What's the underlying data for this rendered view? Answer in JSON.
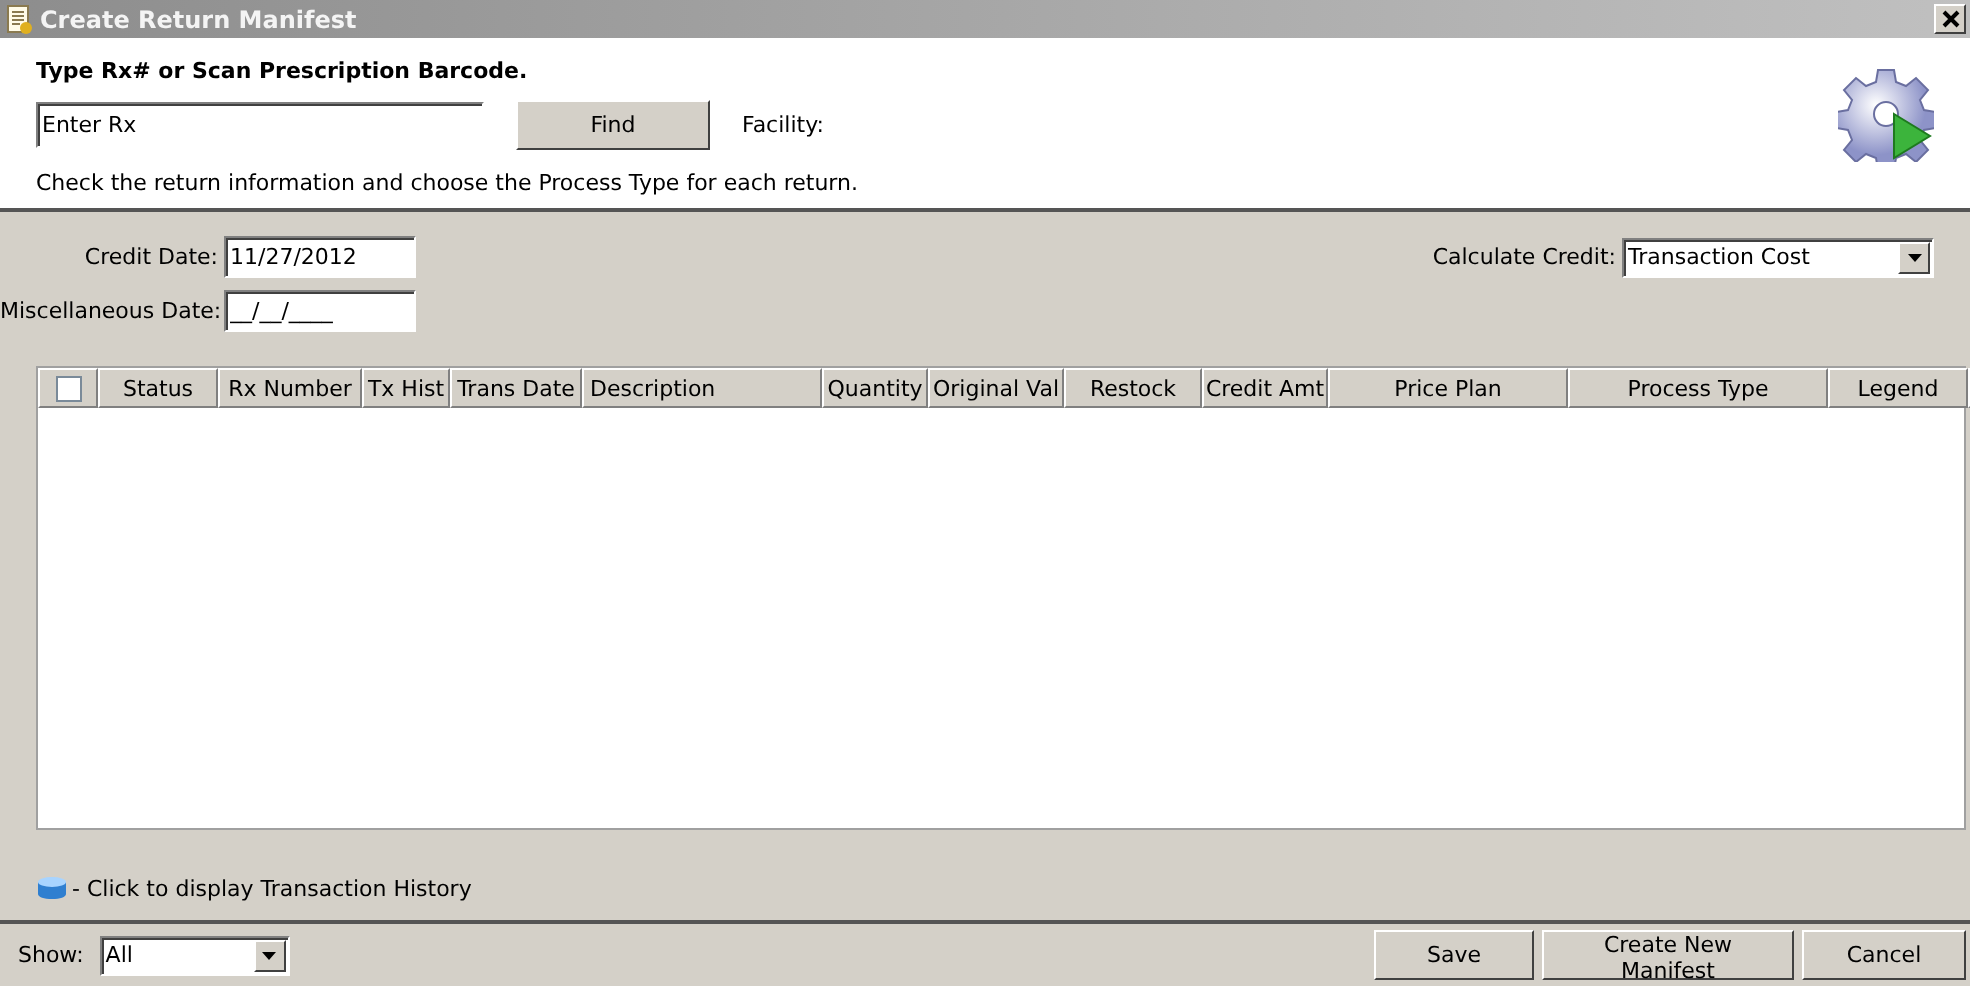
{
  "window": {
    "title": "Create Return Manifest"
  },
  "search": {
    "heading": "Type Rx# or Scan Prescription Barcode.",
    "placeholder": "Enter Rx",
    "button": "Find",
    "facility_label": "Facility:"
  },
  "instructions": "Check the return information and choose the Process Type for each return.",
  "credit_date": {
    "label": "Credit Date:",
    "value": "11/27/2012"
  },
  "calculate_credit": {
    "label": "Calculate Credit:",
    "value": "Transaction Cost"
  },
  "miscellaneous_date": {
    "label": "Miscellaneous Date:",
    "value": "__/__/____"
  },
  "table": {
    "select_all_checked": false,
    "columns": [
      "Status",
      "Rx Number",
      "Tx Hist",
      "Trans Date",
      "Description",
      "Quantity",
      "Original Val",
      "Restock",
      "Credit Amt",
      "Price Plan",
      "Process Type",
      "Legend"
    ]
  },
  "legend_note": "- Click to display Transaction History",
  "show_filter": {
    "label": "Show:",
    "value": "All"
  },
  "buttons": [
    "Save",
    "Create New Manifest",
    "Cancel"
  ]
}
